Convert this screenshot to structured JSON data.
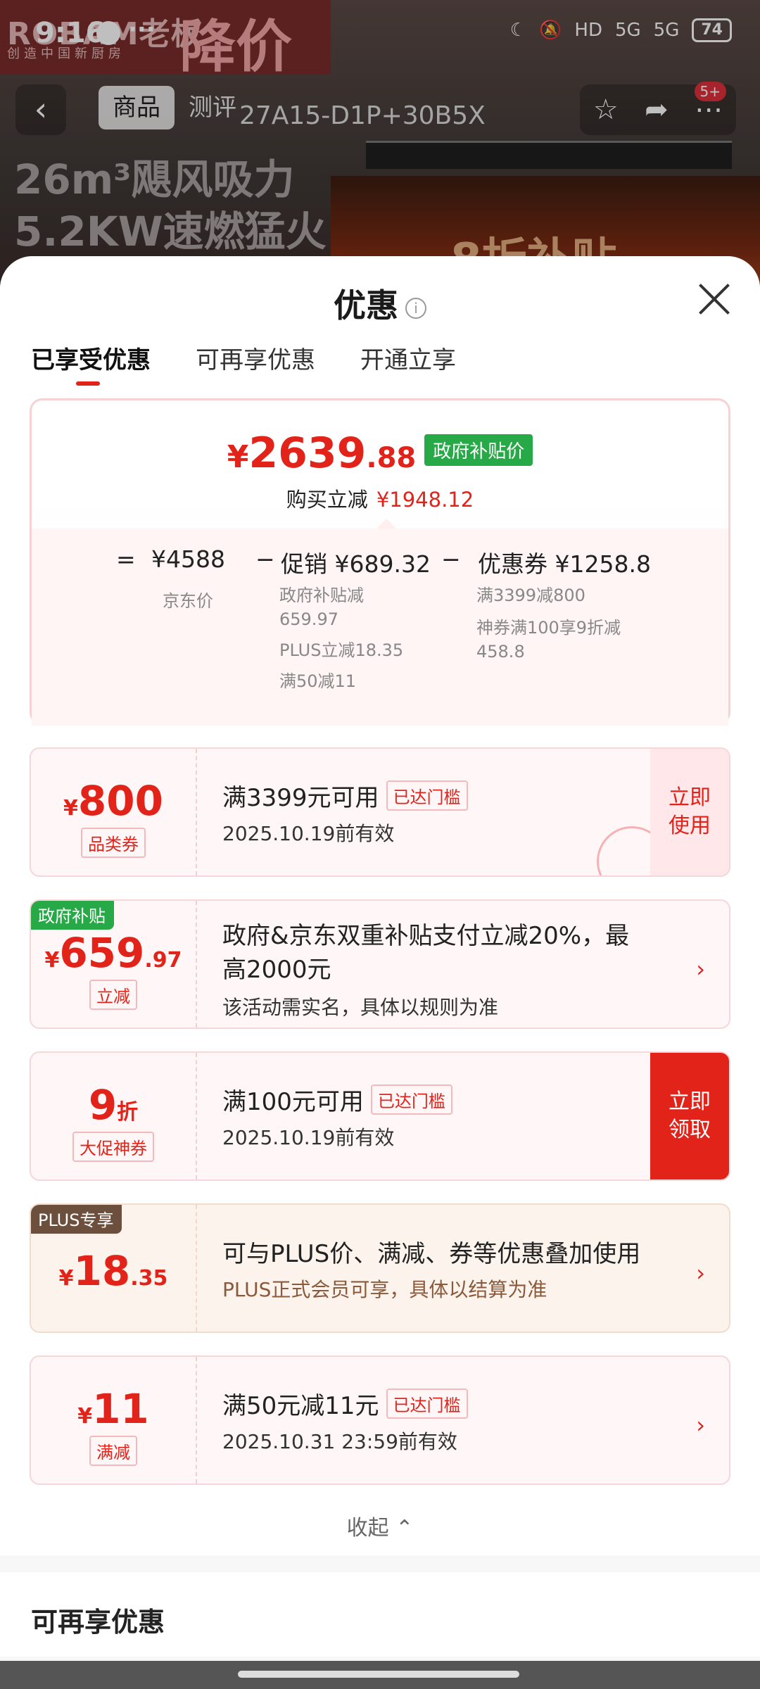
{
  "status_bar": {
    "time": "9:16",
    "dots": "···",
    "battery": "74",
    "network": "5G",
    "hd": "HD"
  },
  "background": {
    "brand": "ROBAM老板",
    "slogan": "创造中国新厨房",
    "sale_text": "降价",
    "line1": "26m³飓风吸力",
    "line2": "5.2KW速燃猛火",
    "fire_text": "8折补贴"
  },
  "top_nav": {
    "back_icon": "‹",
    "tabs": [
      "商品",
      "测评"
    ],
    "model": "27A15-D1P+30B5X",
    "badge": "5+"
  },
  "sheet": {
    "title": "优惠",
    "info_icon": "i",
    "tabs": [
      "已享受优惠",
      "可再享优惠",
      "开通立享"
    ],
    "summary": {
      "price_symbol": "¥",
      "price_int": "2639",
      "price_dec": ".88",
      "gov_tag": "政府补贴价",
      "save_label": "购买立减",
      "save_value": "¥1948.12",
      "eq": "=",
      "jd_price": "¥4588",
      "jd_label": "京东价",
      "minus1": "−",
      "promo": "促销 ¥689.32",
      "promo_details": [
        "政府补贴减",
        "659.97",
        "PLUS立减18.35",
        "满50减11"
      ],
      "minus2": "−",
      "coupon": "优惠券 ¥1258.8",
      "coupon_details": [
        "满3399减800",
        "神券满100享9折减",
        "458.8"
      ]
    },
    "coupons": [
      {
        "symbol": "¥",
        "num": "800",
        "dec": "",
        "type": "品类券",
        "title": "满3399元可用",
        "badge": "已达门槛",
        "sub": "2025.10.19前有效",
        "action": "立即\n使用"
      },
      {
        "corner": "政府补贴",
        "symbol": "¥",
        "num": "659",
        "dec": ".97",
        "type": "立减",
        "title": "政府&京东双重补贴支付立减20%，最高2000元",
        "sub": "该活动需实名，具体以规则为准",
        "chev": "›"
      },
      {
        "symbol": "",
        "num": "9",
        "dec": "折",
        "type": "大促神券",
        "title": "满100元可用",
        "badge": "已达门槛",
        "sub": "2025.10.19前有效",
        "action": "立即\n领取"
      },
      {
        "corner": "PLUS专享",
        "symbol": "¥",
        "num": "18",
        "dec": ".35",
        "type": "",
        "title": "可与PLUS价、满减、券等优惠叠加使用",
        "sub": "PLUS正式会员可享，具体以结算为准",
        "chev": "›"
      },
      {
        "symbol": "¥",
        "num": "11",
        "dec": "",
        "type": "满减",
        "title": "满50元减11元",
        "badge": "已达门槛",
        "sub": "2025.10.31 23:59前有效",
        "chev": "›"
      }
    ],
    "collapse": "收起 ⌃",
    "section2_title": "可再享优惠"
  }
}
